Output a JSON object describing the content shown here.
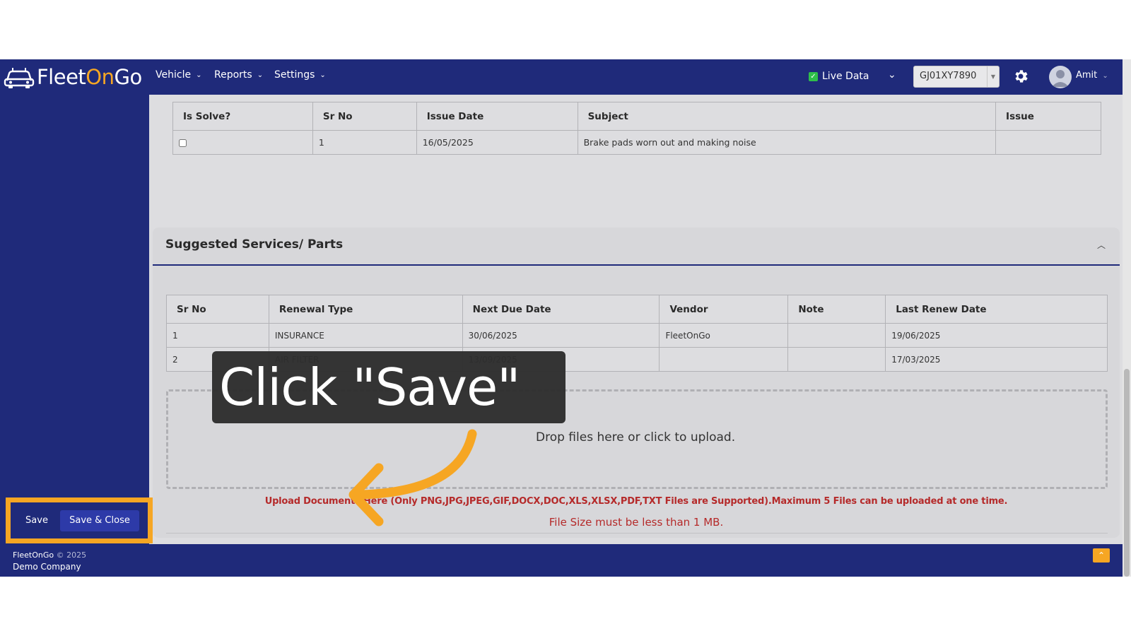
{
  "header": {
    "logo": {
      "part1": "Fleet",
      "part2": "On",
      "part3": "Go"
    },
    "nav": [
      {
        "label": "Vehicle"
      },
      {
        "label": "Reports"
      },
      {
        "label": "Settings"
      }
    ],
    "live_data_label": "Live Data",
    "vehicle_select": "GJ01XY7890",
    "user_name": "Amit",
    "icons": {
      "gear": "gear-icon",
      "avatar": "user-avatar-icon",
      "logo": "car-logo-icon"
    }
  },
  "issues_table": {
    "headers": [
      "Is Solve?",
      "Sr No",
      "Issue Date",
      "Subject",
      "Issue"
    ],
    "rows": [
      {
        "sr_no": "1",
        "issue_date": "16/05/2025",
        "subject": "Brake pads worn out and making noise",
        "issue": ""
      }
    ]
  },
  "services_card": {
    "title": "Suggested Services/ Parts",
    "headers": [
      "Sr No",
      "Renewal Type",
      "Next Due Date",
      "Vendor",
      "Note",
      "Last Renew Date"
    ],
    "rows": [
      {
        "sr_no": "1",
        "renewal_type": "INSURANCE",
        "next_due": "30/06/2025",
        "vendor": "FleetOnGo",
        "note": "",
        "last_renew": "19/06/2025"
      },
      {
        "sr_no": "2",
        "renewal_type": "AIR FILTER",
        "next_due": "13/09/2025",
        "vendor": "",
        "note": "",
        "last_renew": "17/03/2025"
      }
    ]
  },
  "upload": {
    "dropzone_text": "Drop files here or click to upload.",
    "note": "Upload Documents Here (Only PNG,JPG,JPEG,GIF,DOCX,DOC,XLS,XLSX,PDF,TXT Files are Supported).Maximum 5 Files can be uploaded at one time.",
    "size_note": "File Size must be less than 1 MB."
  },
  "buttons": {
    "save": "Save",
    "save_close": "Save & Close"
  },
  "footer": {
    "brand": "FleetOnGo",
    "copyright": "© 2025",
    "company": "Demo Company"
  },
  "overlay": {
    "callout": "Click \"Save\""
  },
  "colors": {
    "navy": "#1f2a7a",
    "accent": "#f6a623",
    "error": "#b52a2a"
  }
}
